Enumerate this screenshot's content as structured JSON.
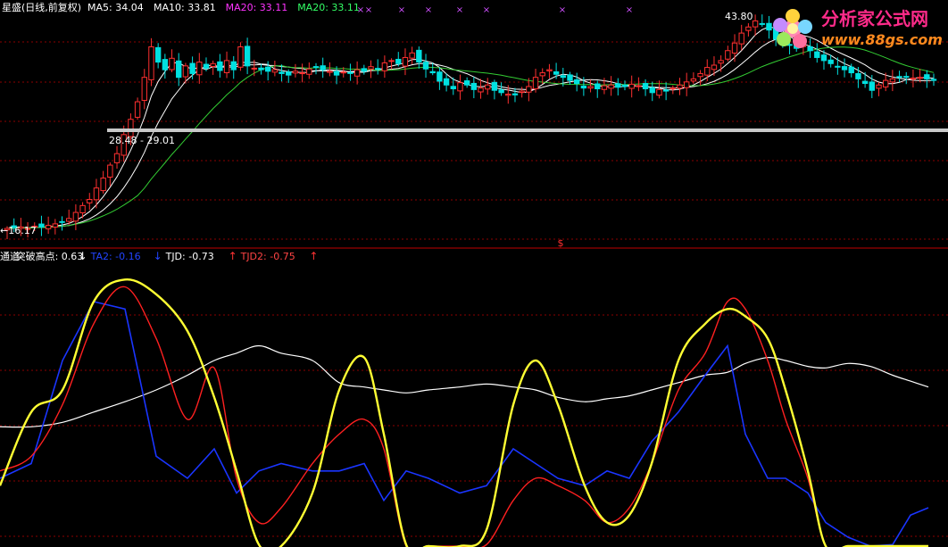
{
  "chart_data": [
    {
      "type": "candlestick",
      "header": {
        "title": "星盛(日线,前复权)",
        "items": [
          {
            "label": "MA5: 34.04",
            "color": "#ffffff"
          },
          {
            "label": "MA10: 33.81",
            "color": "#ffffff"
          },
          {
            "label": "MA20: 33.11",
            "color": "#ff33ff"
          },
          {
            "label": "MA20: 33.11",
            "color": "#33ff66"
          }
        ]
      },
      "annotations": {
        "low_label": "16.17",
        "band_label": "28.48 - 29.01",
        "high_label": "43.80"
      },
      "close": [
        16.2,
        16.3,
        16.4,
        16.2,
        16.5,
        16.4,
        16.6,
        16.8,
        17.0,
        17.5,
        18.3,
        19.2,
        20.0,
        21.5,
        22.8,
        24.5,
        26.0,
        28.5,
        30.5,
        32.8,
        36.0,
        40.0,
        38.0,
        37.0,
        38.5,
        36.0,
        37.5,
        36.5,
        38.0,
        37.2,
        37.8,
        36.9,
        38.2,
        37.0,
        40.0,
        37.5,
        37.2,
        37.0,
        36.8,
        37.0,
        36.5,
        36.3,
        36.8,
        36.6,
        37.1,
        37.4,
        37.0,
        36.8,
        36.3,
        36.7,
        36.5,
        37.0,
        36.8,
        37.4,
        37.1,
        37.9,
        38.2,
        37.8,
        38.6,
        39.2,
        38.0,
        37.1,
        36.6,
        35.5,
        35.0,
        34.5,
        35.3,
        35.0,
        34.4,
        34.6,
        35.0,
        34.3,
        34.0,
        33.8,
        33.7,
        34.2,
        34.8,
        36.0,
        36.6,
        37.0,
        36.4,
        36.0,
        35.6,
        35.2,
        34.6,
        34.8,
        34.5,
        34.9,
        35.0,
        34.7,
        34.8,
        35.1,
        34.9,
        34.5,
        34.0,
        34.4,
        34.2,
        34.6,
        35.0,
        35.4,
        35.8,
        36.5,
        37.3,
        37.6,
        38.2,
        39.5,
        40.5,
        41.8,
        42.6,
        43.4,
        43.0,
        42.2,
        41.0,
        40.6,
        40.2,
        39.8,
        40.3,
        39.5,
        38.6,
        38.2,
        37.8,
        37.4,
        37.0,
        36.6,
        35.8,
        35.2,
        34.3,
        35.0,
        35.6,
        35.8,
        36.0,
        36.1,
        35.9,
        36.0,
        35.8,
        35.6
      ]
    },
    {
      "type": "line",
      "header": {
        "items": [
          {
            "label": "通道",
            "color": "#ffffff"
          },
          {
            "label": "突破高点: 0.63",
            "color": "#ffffff",
            "arrow": "↓",
            "arrow_color": "#ffffff"
          },
          {
            "label": "TA2: -0.16",
            "color": "#2244ff",
            "arrow": "↓",
            "arrow_color": "#2244ff"
          },
          {
            "label": "TJD: -0.73",
            "color": "#ffffff",
            "arrow": "↑",
            "arrow_color": "#ff3333"
          },
          {
            "label": "TJD2: -0.75",
            "color": "#ff4444",
            "arrow": "↑",
            "arrow_color": "#ff3333"
          }
        ]
      },
      "marker": "$",
      "ylim": [
        -1.0,
        1.0
      ],
      "x": [
        0,
        35,
        70,
        105,
        140,
        175,
        210,
        240,
        265,
        290,
        315,
        350,
        380,
        408,
        430,
        455,
        480,
        515,
        545,
        575,
        600,
        625,
        655,
        680,
        705,
        730,
        760,
        790,
        815,
        835,
        860,
        880,
        905,
        925,
        950,
        975,
        1000,
        1020,
        1040
      ],
      "series": [
        {
          "name": "TJD",
          "color": "#ffff33",
          "width": 2.4,
          "values": [
            -0.45,
            0.05,
            0.2,
            0.8,
            0.95,
            0.85,
            0.6,
            0.15,
            -0.35,
            -0.85,
            -0.95,
            -0.5,
            0.2,
            0.42,
            -0.1,
            -0.85,
            -1.2,
            -0.95,
            -0.75,
            0.1,
            0.4,
            0.1,
            -0.45,
            -0.7,
            -0.65,
            -0.3,
            0.4,
            0.65,
            0.75,
            0.7,
            0.55,
            0.2,
            -0.35,
            -0.95,
            -1.2,
            -1.25,
            -1.2,
            -1.1,
            -0.95
          ]
        },
        {
          "name": "TJD2",
          "color": "#ff2020",
          "width": 1.4,
          "values": [
            -0.35,
            -0.25,
            0.1,
            0.65,
            0.9,
            0.55,
            0.0,
            0.35,
            -0.4,
            -0.7,
            -0.6,
            -0.3,
            -0.1,
            0.0,
            -0.2,
            -0.9,
            -1.15,
            -1.05,
            -0.85,
            -0.55,
            -0.4,
            -0.45,
            -0.55,
            -0.7,
            -0.6,
            -0.3,
            0.2,
            0.45,
            0.8,
            0.75,
            0.4,
            0.0,
            -0.4,
            -0.9,
            -1.15,
            -1.25,
            -1.3,
            -1.25,
            -1.1
          ]
        },
        {
          "name": "TA2",
          "color": "#1a35ff",
          "width": 1.6,
          "values": [
            -0.4,
            -0.3,
            0.4,
            0.8,
            0.75,
            -0.25,
            -0.4,
            -0.2,
            -0.5,
            -0.35,
            -0.3,
            -0.35,
            -0.35,
            -0.3,
            -0.55,
            -0.35,
            -0.4,
            -0.5,
            -0.45,
            -0.2,
            -0.3,
            -0.4,
            -0.45,
            -0.35,
            -0.4,
            -0.15,
            0.05,
            0.3,
            0.5,
            -0.1,
            -0.4,
            -0.4,
            -0.5,
            -0.7,
            -0.8,
            -0.9,
            -0.85,
            -0.65,
            -0.6
          ]
        },
        {
          "name": "突破高点",
          "color": "#ffffff",
          "width": 1.2,
          "values": [
            -0.05,
            -0.05,
            -0.02,
            0.05,
            0.12,
            0.2,
            0.3,
            0.4,
            0.45,
            0.5,
            0.45,
            0.4,
            0.25,
            0.22,
            0.2,
            0.18,
            0.2,
            0.22,
            0.24,
            0.22,
            0.2,
            0.15,
            0.12,
            0.14,
            0.16,
            0.2,
            0.25,
            0.3,
            0.32,
            0.38,
            0.42,
            0.4,
            0.36,
            0.35,
            0.38,
            0.36,
            0.3,
            0.26,
            0.22
          ]
        }
      ]
    }
  ],
  "logo": {
    "line1": "分析家公式网",
    "line2": "www.88gs.com"
  }
}
